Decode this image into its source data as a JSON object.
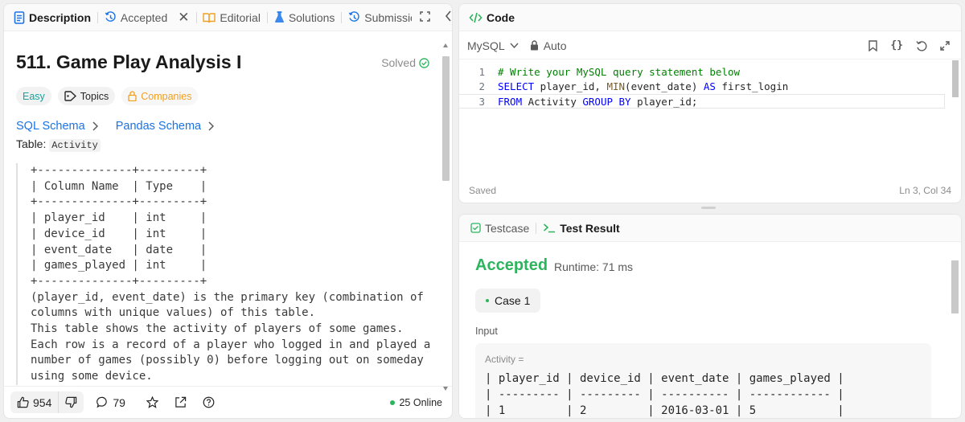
{
  "left": {
    "tabs": [
      {
        "label": "Description",
        "icon": "description-icon"
      },
      {
        "label": "Accepted",
        "icon": "history-icon"
      },
      {
        "label": "Editorial",
        "icon": "book-icon"
      },
      {
        "label": "Solutions",
        "icon": "flask-icon"
      },
      {
        "label": "Submission",
        "icon": "history-icon"
      }
    ],
    "problem": {
      "title": "511. Game Play Analysis I",
      "status": "Solved",
      "difficulty": "Easy",
      "topics_label": "Topics",
      "companies_label": "Companies",
      "schema_links": [
        "SQL Schema",
        "Pandas Schema"
      ],
      "table_prefix": "Table: ",
      "table_name": "Activity",
      "description_block": "+--------------+---------+\n| Column Name  | Type    |\n+--------------+---------+\n| player_id    | int     |\n| device_id    | int     |\n| event_date   | date    |\n| games_played | int     |\n+--------------+---------+\n(player_id, event_date) is the primary key (combination of\ncolumns with unique values) of this table.\nThis table shows the activity of players of some games.\nEach row is a record of a player who logged in and played a\nnumber of games (possibly 0) before logging out on someday\nusing some device."
    },
    "footer": {
      "likes": "954",
      "comments": "79",
      "online": "25 Online"
    }
  },
  "code": {
    "title": "Code",
    "language": "MySQL",
    "mode": "Auto",
    "lines": [
      {
        "num": "1",
        "tokens": [
          {
            "t": "# Write your MySQL query statement below",
            "c": "c-comment"
          }
        ]
      },
      {
        "num": "2",
        "tokens": [
          {
            "t": "SELECT",
            "c": "c-kw"
          },
          {
            "t": " player_id, ",
            "c": ""
          },
          {
            "t": "MIN",
            "c": "c-fn"
          },
          {
            "t": "(event_date) ",
            "c": ""
          },
          {
            "t": "AS",
            "c": "c-kw"
          },
          {
            "t": " first_login",
            "c": ""
          }
        ]
      },
      {
        "num": "3",
        "tokens": [
          {
            "t": "FROM",
            "c": "c-kw"
          },
          {
            "t": " Activity ",
            "c": ""
          },
          {
            "t": "GROUP BY",
            "c": "c-kw"
          },
          {
            "t": " player_id;",
            "c": ""
          }
        ]
      }
    ],
    "saved": "Saved",
    "cursor": "Ln 3, Col 34"
  },
  "result": {
    "tabs": [
      {
        "label": "Testcase",
        "icon": "checkbox-icon"
      },
      {
        "label": "Test Result",
        "icon": "terminal-icon"
      }
    ],
    "status": "Accepted",
    "runtime": "Runtime: 71 ms",
    "case_label": "Case 1",
    "input_label": "Input",
    "input_var": "Activity =",
    "input_table": "| player_id | device_id | event_date | games_played |\n| --------- | --------- | ---------- | ------------ |\n| 1         | 2         | 2016-03-01 | 5            |"
  },
  "colors": {
    "accent_green": "#2db55d",
    "link_blue": "#1a73e8",
    "easy_teal": "#1ca19a",
    "companies_orange": "#f0a020"
  }
}
